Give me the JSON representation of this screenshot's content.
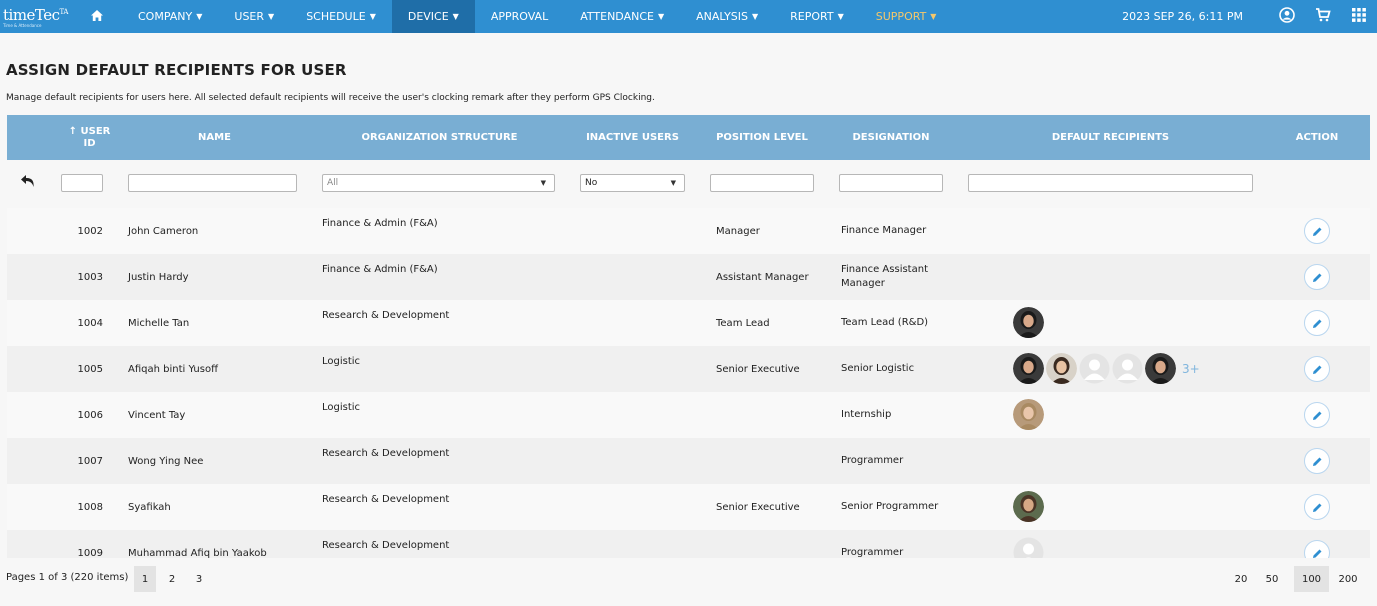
{
  "nav": {
    "logo_main": "timeTec",
    "logo_sup": "TA",
    "logo_sub": "Time & Attendance",
    "items": [
      {
        "label": "COMPANY",
        "caret": true
      },
      {
        "label": "USER",
        "caret": true
      },
      {
        "label": "SCHEDULE",
        "caret": true
      },
      {
        "label": "DEVICE",
        "caret": true,
        "active": true
      },
      {
        "label": "APPROVAL",
        "caret": false
      },
      {
        "label": "ATTENDANCE",
        "caret": true
      },
      {
        "label": "ANALYSIS",
        "caret": true
      },
      {
        "label": "REPORT",
        "caret": true
      },
      {
        "label": "SUPPORT",
        "caret": true
      }
    ],
    "datetime": "2023 SEP 26, 6:11 PM",
    "icons": [
      "home-icon",
      "user-circle-icon",
      "cart-icon",
      "grid-icon"
    ],
    "colors": {
      "bar": "#2f8fd1",
      "active": "#1f6ea8",
      "support": "#f5c86b"
    }
  },
  "page": {
    "title": "ASSIGN DEFAULT RECIPIENTS FOR USER",
    "description": "Manage default recipients for users here. All selected default recipients will receive the user's clocking remark after they perform GPS Clocking."
  },
  "table": {
    "headers": {
      "user_id_sort": "↑",
      "user_id": "USER ID",
      "name": "NAME",
      "org": "ORGANIZATION STRUCTURE",
      "inactive": "INACTIVE USERS",
      "position": "POSITION LEVEL",
      "designation": "DESIGNATION",
      "recipients": "DEFAULT RECIPIENTS",
      "action": "ACTION"
    },
    "filters": {
      "org_value": "All",
      "inactive_value": "No"
    },
    "rows": [
      {
        "id": "1002",
        "name": "John Cameron",
        "org": "Finance & Admin (F&A)",
        "position": "Manager",
        "designation": "Finance Manager",
        "recipients": []
      },
      {
        "id": "1003",
        "name": "Justin Hardy",
        "org": "Finance & Admin (F&A)",
        "position": "Assistant Manager",
        "designation": "Finance Assistant Manager",
        "recipients": []
      },
      {
        "id": "1004",
        "name": "Michelle Tan",
        "org": "Research & Development",
        "position": "Team Lead",
        "designation": "Team Lead (R&D)",
        "recipients": [
          "photo-dark"
        ]
      },
      {
        "id": "1005",
        "name": "Afiqah binti Yusoff",
        "org": "Logistic",
        "position": "Senior Executive",
        "designation": "Senior Logistic",
        "recipients": [
          "photo-dark",
          "photo-light",
          "blank",
          "blank",
          "photo-dark"
        ],
        "more": "3+"
      },
      {
        "id": "1006",
        "name": "Vincent Tay",
        "org": "Logistic",
        "position": "",
        "designation": "Internship",
        "recipients": [
          "photo-blond"
        ]
      },
      {
        "id": "1007",
        "name": "Wong Ying Nee",
        "org": "Research & Development",
        "position": "",
        "designation": "Programmer",
        "recipients": []
      },
      {
        "id": "1008",
        "name": "Syafikah",
        "org": "Research & Development",
        "position": "Senior Executive",
        "designation": "Senior Programmer",
        "recipients": [
          "photo-brown"
        ]
      },
      {
        "id": "1009",
        "name": "Muhammad Afiq bin Yaakob",
        "org": "Research & Development",
        "position": "",
        "designation": "Programmer",
        "recipients": [
          "blank"
        ]
      }
    ]
  },
  "pager": {
    "info": "Pages 1 of 3 (220 items)",
    "pages": [
      "1",
      "2",
      "3"
    ],
    "current_page": "1",
    "sizes": [
      "20",
      "50",
      "100",
      "200"
    ],
    "current_size": "100"
  }
}
